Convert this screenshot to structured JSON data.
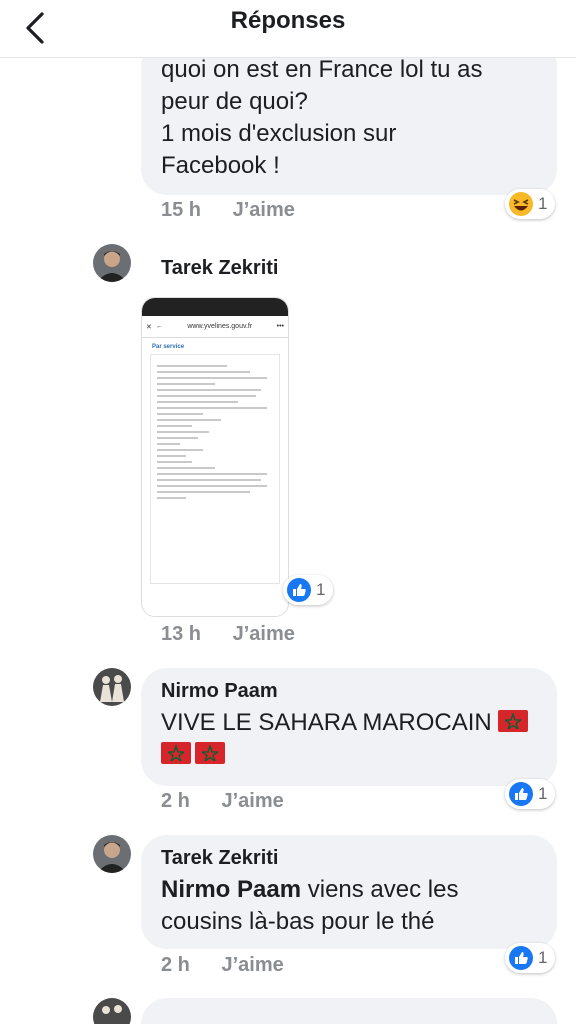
{
  "header": {
    "title": "Réponses",
    "back_icon": "chevron-left-icon"
  },
  "comments": [
    {
      "text_lines": [
        "quoi on est en France lol tu as",
        "peur de quoi?",
        "1 mois d'exclusion sur",
        "Facebook !"
      ],
      "time": "15 h",
      "like_label": "J’aime",
      "reaction": {
        "icon": "haha-icon",
        "count": "1"
      }
    },
    {
      "author": "Tarek Zekriti",
      "image": {
        "url": "www.yvelines.gouv.fr",
        "section": "Par service",
        "close": "✕",
        "back": "←",
        "more": "•••"
      },
      "time": "13 h",
      "like_label": "J’aime",
      "reaction": {
        "icon": "like-icon",
        "count": "1"
      }
    },
    {
      "author": "Nirmo Paam",
      "text": "VIVE LE SAHARA MAROCAIN",
      "flags": [
        "morocco-flag",
        "morocco-flag",
        "morocco-flag"
      ],
      "time": "2 h",
      "like_label": "J’aime",
      "reaction": {
        "icon": "like-icon",
        "count": "1"
      }
    },
    {
      "author": "Tarek Zekriti",
      "mention": "Nirmo Paam",
      "text_line1_rest": " viens avec les",
      "text_line2": "cousins là-bas pour le thé",
      "time": "2 h",
      "like_label": "J’aime",
      "reaction": {
        "icon": "like-icon",
        "count": "1"
      }
    }
  ],
  "colors": {
    "bubble": "#f0f2f5",
    "meta": "#8a8d91",
    "like_blue": "#1877f2",
    "haha_yellow": "#f7b928",
    "flag_red": "#d7262b",
    "flag_star": "#006233"
  }
}
